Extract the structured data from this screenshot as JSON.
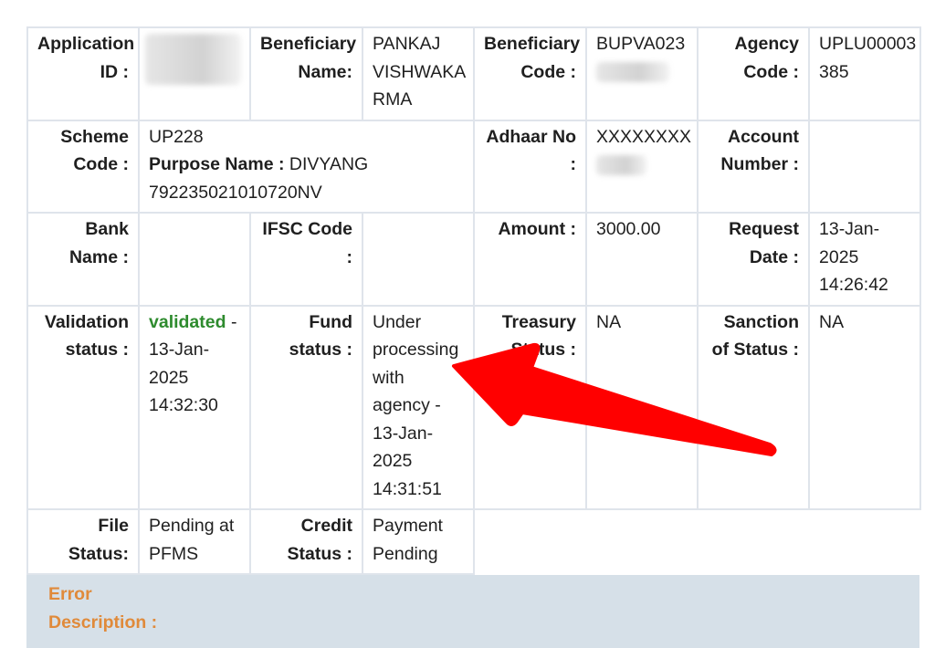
{
  "rows": [
    {
      "cells": [
        {
          "label": "Application ID :",
          "value": ""
        },
        {
          "label": "Beneficiary Name:",
          "value": "PANKAJ VISHWAKA RMA"
        },
        {
          "label": "Beneficiary Code :",
          "value": "BUPVA023"
        },
        {
          "label": "Agency Code :",
          "value": "UPLU00003 385"
        }
      ]
    }
  ],
  "application_id": {
    "label": "Application ID :",
    "value_redacted": true
  },
  "beneficiary_name": {
    "label": "Beneficiary Name:",
    "value": "PANKAJ VISHWAKA RMA"
  },
  "beneficiary_code": {
    "label": "Beneficiary Code :",
    "value": "BUPVA023",
    "value_partially_redacted": true
  },
  "agency_code": {
    "label": "Agency Code :",
    "value": "UPLU00003 385"
  },
  "scheme_code": {
    "label": "Scheme Code :",
    "value": "UP228",
    "purpose_label": "Purpose Name :",
    "purpose_value": "DIVYANG",
    "purpose_ref": "792235021010720NV"
  },
  "adhaar_no": {
    "label": "Adhaar No :",
    "value": "XXXXXXXX",
    "value_partially_redacted": true
  },
  "account_number": {
    "label": "Account Number :",
    "value": ""
  },
  "bank_name": {
    "label": "Bank Name :",
    "value": ""
  },
  "ifsc_code": {
    "label": "IFSC Code :",
    "value": ""
  },
  "amount": {
    "label": "Amount :",
    "value": "3000.00"
  },
  "request_date": {
    "label": "Request Date :",
    "value": "13-Jan- 2025 14:26:42"
  },
  "validation_status": {
    "label": "Validation status :",
    "status": "validated",
    "suffix": " - 13-Jan- 2025 14:32:30",
    "status_color": "#2e8b2e"
  },
  "fund_status": {
    "label": "Fund status :",
    "value": "Under processing with agency - 13-Jan- 2025 14:31:51"
  },
  "treasury_status": {
    "label": "Treasury Status :",
    "value": "NA"
  },
  "sanction_status": {
    "label": "Sanction of Status :",
    "value": "NA"
  },
  "file_status": {
    "label": "File Status:",
    "value": "Pending at PFMS"
  },
  "credit_status": {
    "label": "Credit Status :",
    "value": "Payment Pending"
  },
  "error_description": {
    "label": "Error Description :",
    "value": ""
  },
  "annotation": {
    "type": "arrow",
    "color": "#ff0000",
    "points_to": "fund_status"
  },
  "colors": {
    "label": "#23508f",
    "border": "#dfe4eb",
    "error_bg": "#d6e0e8",
    "error_label": "#e08a3a"
  }
}
